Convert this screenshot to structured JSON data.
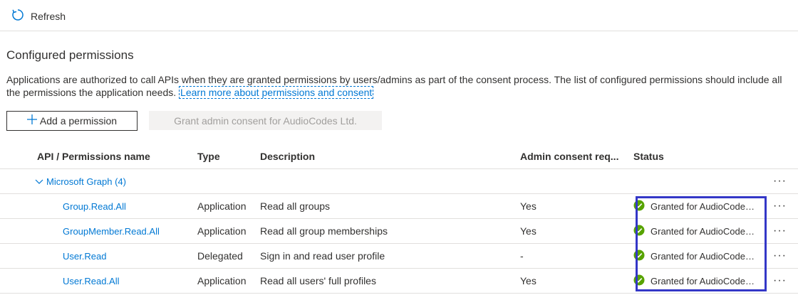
{
  "toolbar": {
    "refresh_label": "Refresh"
  },
  "section": {
    "title": "Configured permissions",
    "description": "Applications are authorized to call APIs when they are granted permissions by users/admins as part of the consent process. The list of configured permissions should include all the permissions the application needs.",
    "learn_more": "Learn more about permissions and consent"
  },
  "buttons": {
    "add_permission": "Add a permission",
    "grant_consent": "Grant admin consent for AudioCodes Ltd."
  },
  "table": {
    "headers": [
      "API / Permissions name",
      "Type",
      "Description",
      "Admin consent req...",
      "Status"
    ],
    "group": {
      "label": "Microsoft Graph (4)"
    },
    "rows": [
      {
        "name": "Group.Read.All",
        "type": "Application",
        "description": "Read all groups",
        "admin_consent": "Yes",
        "status": "Granted for AudioCodes Ltd."
      },
      {
        "name": "GroupMember.Read.All",
        "type": "Application",
        "description": "Read all group memberships",
        "admin_consent": "Yes",
        "status": "Granted for AudioCodes Ltd."
      },
      {
        "name": "User.Read",
        "type": "Delegated",
        "description": "Sign in and read user profile",
        "admin_consent": "-",
        "status": "Granted for AudioCodes Ltd."
      },
      {
        "name": "User.Read.All",
        "type": "Application",
        "description": "Read all users' full profiles",
        "admin_consent": "Yes",
        "status": "Granted for AudioCodes Ltd."
      }
    ],
    "more_label": "···"
  },
  "colors": {
    "accent": "#0078d4",
    "success": "#57a300",
    "highlight": "#3437c7"
  },
  "icons": {
    "refresh": "refresh-icon",
    "plus": "plus-icon",
    "chevron": "chevron-down-icon",
    "check": "check-circle-icon"
  }
}
